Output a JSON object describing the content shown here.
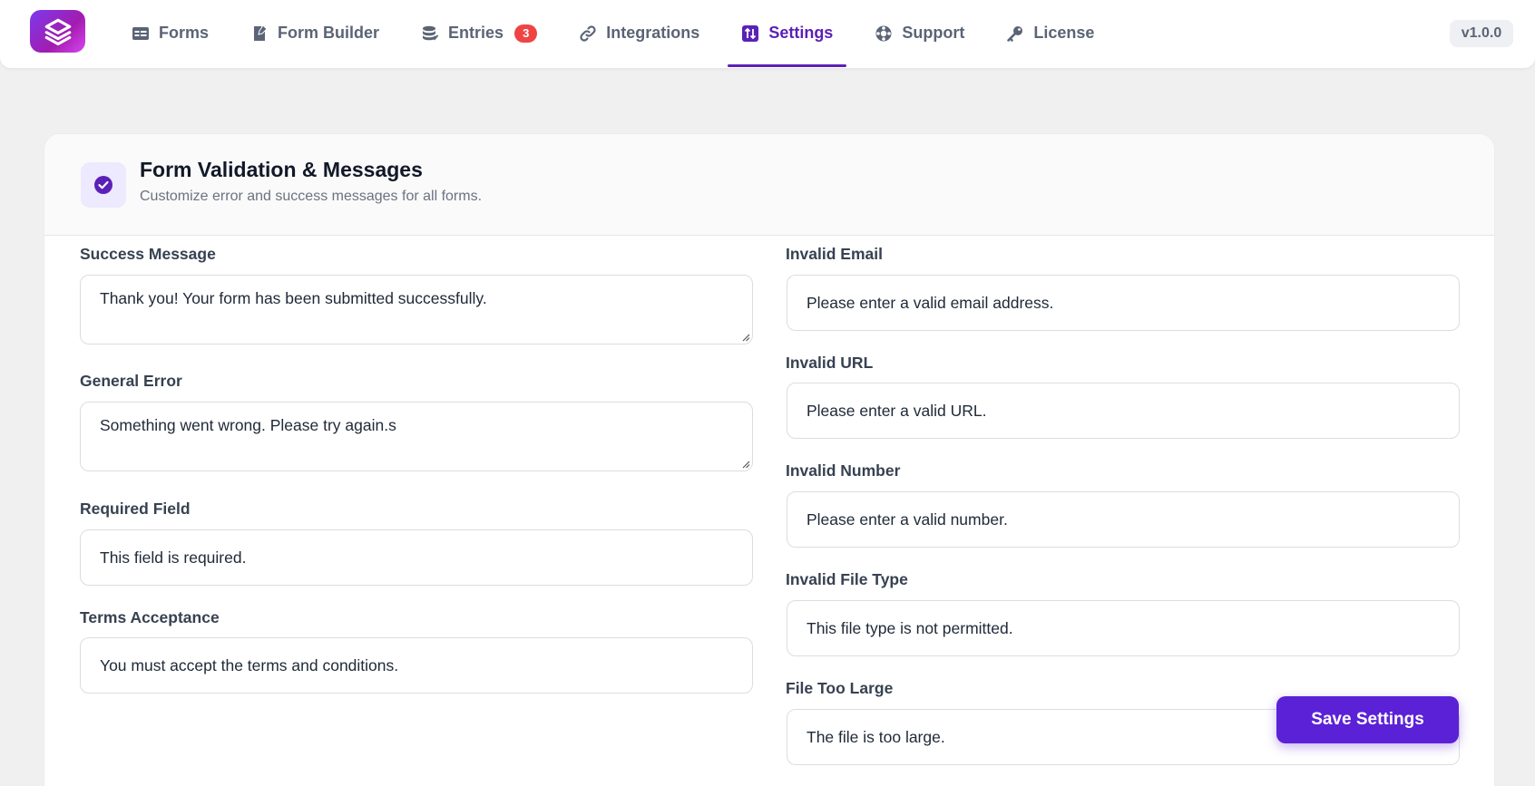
{
  "nav": {
    "items": [
      {
        "label": "Forms",
        "icon": "forms-icon"
      },
      {
        "label": "Form Builder",
        "icon": "form-builder-icon"
      },
      {
        "label": "Entries",
        "icon": "entries-icon",
        "badge": "3"
      },
      {
        "label": "Integrations",
        "icon": "link-icon"
      },
      {
        "label": "Settings",
        "icon": "settings-icon",
        "active": true
      },
      {
        "label": "Support",
        "icon": "support-icon"
      },
      {
        "label": "License",
        "icon": "key-icon"
      }
    ],
    "version": "v1.0.0"
  },
  "card": {
    "title": "Form Validation & Messages",
    "subtitle": "Customize error and success messages for all forms."
  },
  "left_fields": [
    {
      "label": "Success Message",
      "value": "Thank you! Your form has been submitted successfully.",
      "type": "textarea"
    },
    {
      "label": "General Error",
      "value": "Something went wrong. Please try again.s",
      "type": "textarea"
    },
    {
      "label": "Required Field",
      "value": "This field is required.",
      "type": "input"
    },
    {
      "label": "Terms Acceptance",
      "value": "You must accept the terms and conditions.",
      "type": "input"
    }
  ],
  "right_fields": [
    {
      "label": "Invalid Email",
      "value": "Please enter a valid email address.",
      "type": "input"
    },
    {
      "label": "Invalid URL",
      "value": "Please enter a valid URL.",
      "type": "input"
    },
    {
      "label": "Invalid Number",
      "value": "Please enter a valid number.",
      "type": "input"
    },
    {
      "label": "Invalid File Type",
      "value": "This file type is not permitted.",
      "type": "input"
    },
    {
      "label": "File Too Large",
      "value": "The file is too large.",
      "type": "input"
    }
  ],
  "actions": {
    "save_label": "Save Settings"
  },
  "colors": {
    "accent": "#5b21b6",
    "button": "#5b21d6",
    "badge": "#ef4444"
  }
}
